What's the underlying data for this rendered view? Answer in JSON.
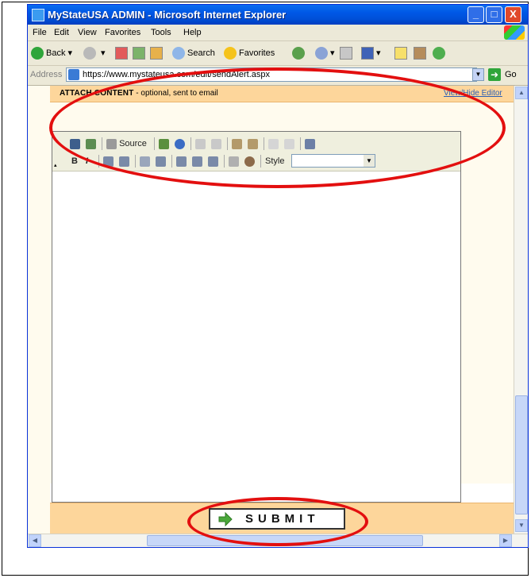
{
  "window": {
    "title": "MyStateUSA ADMIN - Microsoft Internet Explorer",
    "controls": [
      "_",
      "□",
      "X"
    ]
  },
  "menu": [
    "File",
    "Edit",
    "View",
    "Favorites",
    "Tools",
    "Help"
  ],
  "toolbar": {
    "back_label": "Back",
    "search_label": "Search",
    "favorites_label": "Favorites"
  },
  "address": {
    "label": "Address",
    "url": "https://www.mystateusa.com/edit/sendAlert.aspx",
    "go_label": "Go"
  },
  "attach": {
    "heading": "ATTACH CONTENT",
    "note": " - optional, sent to email",
    "toggle_link": "View/Hide Editor"
  },
  "editor": {
    "source_label": "Source",
    "style_label": "Style",
    "style_value": ""
  },
  "submit": {
    "label": "SUBMIT"
  },
  "colors": {
    "title_bar": "#0058e6",
    "panel_orange": "#fdd69b",
    "annotation_red": "#e30f0f",
    "link_blue": "#2b5fb4"
  }
}
